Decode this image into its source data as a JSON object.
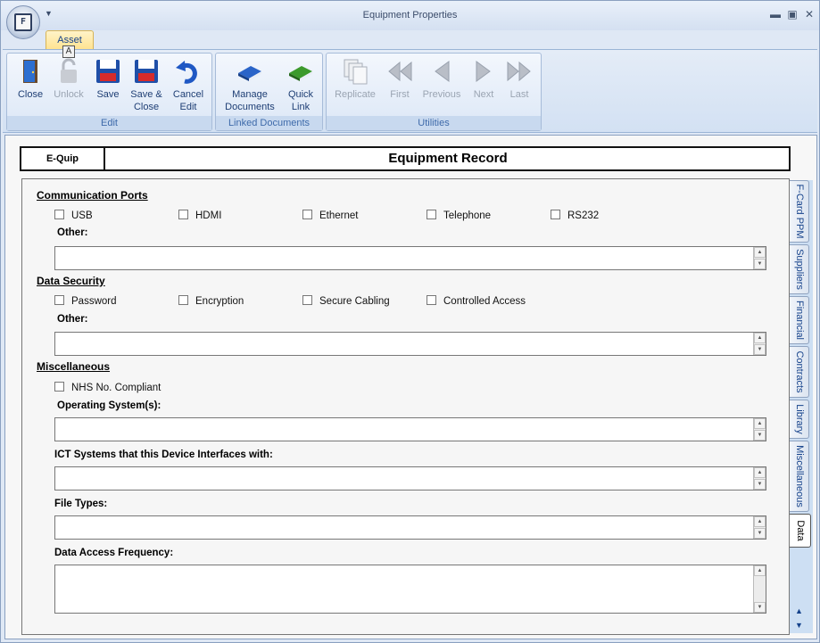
{
  "window": {
    "title": "Equipment Properties",
    "app_icon_letter": "F"
  },
  "ribbon": {
    "tab": "Asset",
    "keytip": "A",
    "groups": {
      "edit": "Edit",
      "linked": "Linked Documents",
      "utilities": "Utilities"
    },
    "buttons": {
      "close": [
        "Close",
        ""
      ],
      "unlock": [
        "Unlock",
        ""
      ],
      "save": [
        "Save",
        ""
      ],
      "save_close": [
        "Save &",
        "Close"
      ],
      "cancel_edit": [
        "Cancel",
        "Edit"
      ],
      "manage_docs": [
        "Manage",
        "Documents"
      ],
      "quick_link": [
        "Quick",
        "Link"
      ],
      "replicate": [
        "Replicate",
        ""
      ],
      "first": [
        "First",
        ""
      ],
      "previous": [
        "Previous",
        ""
      ],
      "next": [
        "Next",
        ""
      ],
      "last": [
        "Last",
        ""
      ]
    }
  },
  "record": {
    "brand": "E-Quip",
    "title": "Equipment Record"
  },
  "form": {
    "comm_ports": {
      "heading": "Communication Ports",
      "options": [
        "USB",
        "HDMI",
        "Ethernet",
        "Telephone",
        "RS232"
      ],
      "other_label": "Other:",
      "other_value": ""
    },
    "data_security": {
      "heading": "Data Security",
      "options": [
        "Password",
        "Encryption",
        "Secure Cabling",
        "Controlled Access"
      ],
      "other_label": "Other:",
      "other_value": ""
    },
    "misc": {
      "heading": "Miscellaneous",
      "nhs_label": "NHS No. Compliant",
      "os_label": "Operating System(s):",
      "ict_label": "ICT Systems that this Device Interfaces with:",
      "file_types_label": "File Types:",
      "access_freq_label": "Data Access Frequency:"
    }
  },
  "side_tabs": [
    "F-Card PPM",
    "Suppliers",
    "Financial",
    "Contracts",
    "Library",
    "Miscellaneous",
    "Data"
  ],
  "active_tab": "Data"
}
